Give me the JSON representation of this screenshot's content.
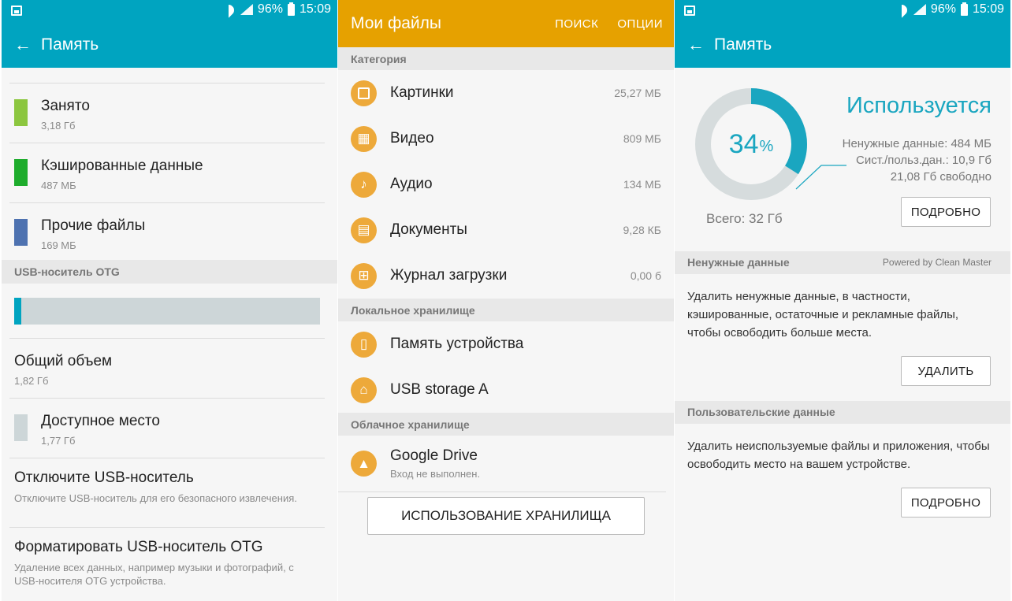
{
  "status": {
    "battery": "96%",
    "time": "15:09"
  },
  "panel1": {
    "title": "Память",
    "items": [
      {
        "title": "Занято",
        "sub": "3,18 Гб",
        "color": "#8cc63f"
      },
      {
        "title": "Кэшированные данные",
        "sub": "487 МБ",
        "color": "#1eac2c"
      },
      {
        "title": "Прочие файлы",
        "sub": "169 МБ",
        "color": "#4e72b0"
      }
    ],
    "usb_header": "USB-носитель OTG",
    "usb_bar_fill_fraction": 0.022,
    "total_title": "Общий объем",
    "total_value": "1,82 Гб",
    "free_title": "Доступное место",
    "free_value": "1,77 Гб",
    "free_color": "#cdd6d8",
    "eject_title": "Отключите USB-носитель",
    "eject_sub": "Отключите USB-носитель для его безопасного извлечения.",
    "format_title": "Форматировать USB-носитель OTG",
    "format_sub": "Удаление всех данных, например музыки и фотографий, с USB-носителя OTG устройства."
  },
  "panel2": {
    "title": "Мои файлы",
    "search": "ПОИСК",
    "options": "ОПЦИИ",
    "category_header": "Категория",
    "categories": [
      {
        "icon": "image-icon",
        "name": "Картинки",
        "size": "25,27 МБ"
      },
      {
        "icon": "video-icon",
        "name": "Видео",
        "size": "809 МБ"
      },
      {
        "icon": "music-note-icon",
        "name": "Аудио",
        "size": "134 МБ"
      },
      {
        "icon": "document-icon",
        "name": "Документы",
        "size": "9,28 КБ"
      },
      {
        "icon": "download-icon",
        "name": "Журнал загрузки",
        "size": "0,00 б"
      }
    ],
    "local_header": "Локальное хранилище",
    "local": [
      {
        "icon": "phone-icon",
        "name": "Память устройства"
      },
      {
        "icon": "usb-icon",
        "name": "USB storage A"
      }
    ],
    "cloud_header": "Облачное хранилище",
    "cloud_name": "Google Drive",
    "cloud_sub": "Вход не выполнен.",
    "usage_button": "ИСПОЛЬЗОВАНИЕ ХРАНИЛИЩА"
  },
  "panel3": {
    "title": "Память",
    "percent": "34",
    "percent_sign": "%",
    "percent_value": 34,
    "used_label": "Используется",
    "stats": [
      "Ненужные данные: 484 МБ",
      "Сист./польз.дан.: 10,9 Гб",
      "21,08 Гб свободно"
    ],
    "total": "Всего: 32 Гб",
    "details_button": "ПОДРОБНО",
    "junk_header": "Ненужные данные",
    "powered_by": "Powered by Clean Master",
    "junk_text": "Удалить ненужные данные, в частности, кэшированные, остаточные и рекламные файлы, чтобы освободить больше места.",
    "delete_button": "УДАЛИТЬ",
    "user_header": "Пользовательские данные",
    "user_text": "Удалить неиспользуемые файлы и приложения, чтобы освободить место на вашем устройстве.",
    "details_button2": "ПОДРОБНО",
    "ring_color": "#1aa6c0",
    "ring_bg": "#d6dcdd"
  }
}
